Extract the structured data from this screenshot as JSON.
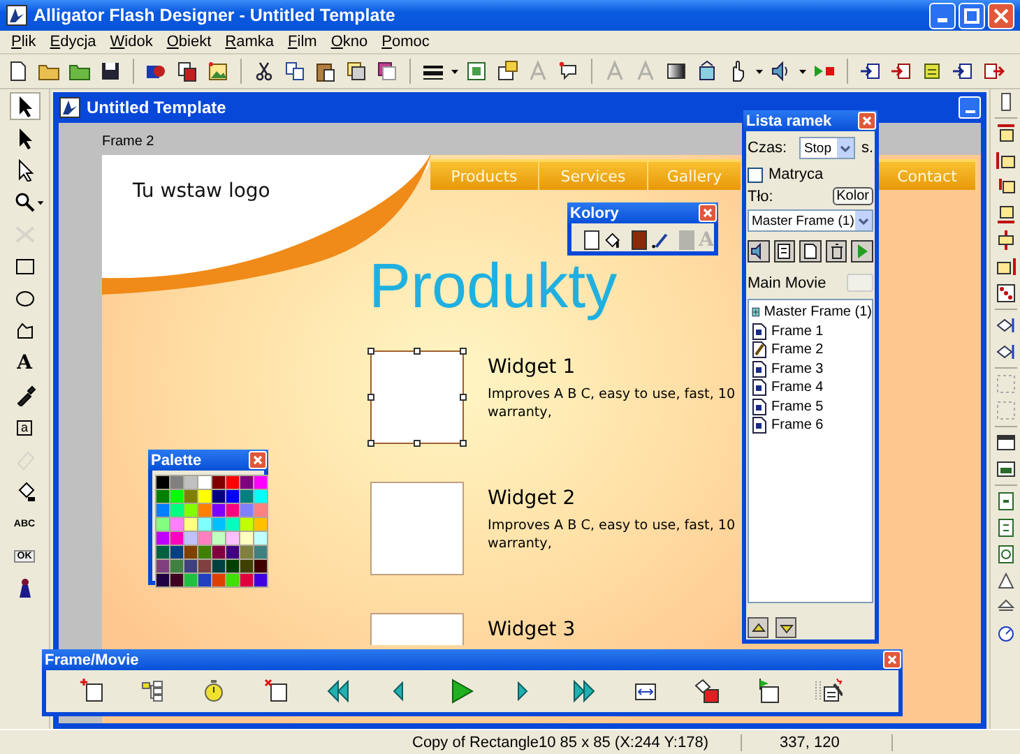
{
  "window": {
    "title": "Alligator Flash Designer - Untitled Template"
  },
  "menu": [
    "Plik",
    "Edycja",
    "Widok",
    "Obiekt",
    "Ramka",
    "Film",
    "Okno",
    "Pomoc"
  ],
  "toolbox": [
    {
      "kind": "select",
      "selected": true,
      "disabled": false
    },
    {
      "kind": "pointer",
      "selected": false,
      "disabled": false
    },
    {
      "kind": "node",
      "selected": false,
      "disabled": false
    },
    {
      "kind": "zoom",
      "selected": false,
      "disabled": false
    },
    {
      "kind": "cross",
      "selected": false,
      "disabled": true
    },
    {
      "kind": "rectangle",
      "selected": false,
      "disabled": false
    },
    {
      "kind": "ellipse",
      "selected": false,
      "disabled": false
    },
    {
      "kind": "polygon",
      "selected": false,
      "disabled": false
    },
    {
      "kind": "text",
      "label": "A",
      "selected": false,
      "disabled": false
    },
    {
      "kind": "dropper",
      "selected": false,
      "disabled": false
    },
    {
      "kind": "edit",
      "label": "a",
      "selected": false,
      "disabled": false
    },
    {
      "kind": "eraser",
      "selected": false,
      "disabled": true
    },
    {
      "kind": "fill",
      "selected": false,
      "disabled": false
    },
    {
      "kind": "label",
      "label": "ABC",
      "selected": false,
      "disabled": false
    },
    {
      "kind": "button",
      "label": "OK",
      "selected": false,
      "disabled": false
    },
    {
      "kind": "figure",
      "selected": false,
      "disabled": false
    }
  ],
  "document": {
    "title": "Untitled Template",
    "frame_label": "Frame 2"
  },
  "page": {
    "logo_text": "Tu wstaw logo",
    "nav": [
      "Products",
      "Services",
      "Gallery",
      "Contact"
    ],
    "heading": "Produkty",
    "widgets": [
      {
        "title": "Widget 1",
        "description": "Improves A B C, easy to use, fast, 10\nwarranty,",
        "selected": true
      },
      {
        "title": "Widget 2",
        "description": "Improves A B C, easy to use, fast, 10\nwarranty,",
        "selected": false
      },
      {
        "title": "Widget 3",
        "selected": false
      }
    ]
  },
  "frame_list": {
    "title": "Lista ramek",
    "time_label": "Czas:",
    "time_value": "Stop",
    "time_unit": "s.",
    "matrix": {
      "label": "Matryca",
      "checked": false
    },
    "background_label": "Tło:",
    "color_button": "Kolor",
    "frame_select": "Master Frame (1)",
    "movie_label": "Main Movie",
    "frames": [
      {
        "label": "Master Frame (1)",
        "kind": "master"
      },
      {
        "label": "Frame 1",
        "kind": "frame"
      },
      {
        "label": "Frame 2",
        "kind": "edited"
      },
      {
        "label": "Frame 3",
        "kind": "frame"
      },
      {
        "label": "Frame 4",
        "kind": "frame"
      },
      {
        "label": "Frame 5",
        "kind": "frame"
      },
      {
        "label": "Frame 6",
        "kind": "frame"
      }
    ]
  },
  "colors_panel": {
    "title": "Kolory",
    "swatches": [
      {
        "kind": "fill",
        "color": "#ffffff"
      },
      {
        "kind": "line",
        "color": "#8b2a0a"
      },
      {
        "kind": "text",
        "color": "#b4b4ac",
        "glyph": "A"
      }
    ]
  },
  "palette": {
    "title": "Palette",
    "colors": [
      {
        "color": "#000000"
      },
      {
        "color": "#808080"
      },
      {
        "color": "#c0c0c0"
      },
      {
        "color": "#ffffff"
      },
      {
        "color": "#800000"
      },
      {
        "color": "#ff0000"
      },
      {
        "color": "#800080"
      },
      {
        "color": "#ff00ff"
      },
      {
        "color": "#008000"
      },
      {
        "color": "#00ff00"
      },
      {
        "color": "#808000"
      },
      {
        "color": "#ffff00"
      },
      {
        "color": "#000080"
      },
      {
        "color": "#0000ff"
      },
      {
        "color": "#008080"
      },
      {
        "color": "#00ffff"
      },
      {
        "color": "#0080ff"
      },
      {
        "color": "#00ff80"
      },
      {
        "color": "#80ff00"
      },
      {
        "color": "#ff8000"
      },
      {
        "color": "#8000ff"
      },
      {
        "color": "#ff0080"
      },
      {
        "color": "#8080ff"
      },
      {
        "color": "#ff8080"
      },
      {
        "color": "#80ff80"
      },
      {
        "color": "#ff80ff"
      },
      {
        "color": "#ffff80"
      },
      {
        "color": "#80ffff"
      },
      {
        "color": "#00c0ff"
      },
      {
        "color": "#00ffc0"
      },
      {
        "color": "#c0ff00"
      },
      {
        "color": "#ffc000"
      },
      {
        "color": "#c000ff"
      },
      {
        "color": "#ff00c0"
      },
      {
        "color": "#c0c0ff"
      },
      {
        "color": "#ff80c0"
      },
      {
        "color": "#c0ffc0"
      },
      {
        "color": "#ffc0ff"
      },
      {
        "color": "#ffffc0"
      },
      {
        "color": "#c0ffff"
      },
      {
        "color": "#006040"
      },
      {
        "color": "#004080"
      },
      {
        "color": "#804000"
      },
      {
        "color": "#408000"
      },
      {
        "color": "#800040"
      },
      {
        "color": "#400080"
      },
      {
        "color": "#808040"
      },
      {
        "color": "#408080"
      },
      {
        "color": "#804080"
      },
      {
        "color": "#408040"
      },
      {
        "color": "#404080"
      },
      {
        "color": "#804040"
      },
      {
        "color": "#004040"
      },
      {
        "color": "#004000"
      },
      {
        "color": "#404000"
      },
      {
        "color": "#400000"
      },
      {
        "color": "#200040"
      },
      {
        "color": "#400020"
      },
      {
        "color": "#20c040"
      },
      {
        "color": "#2040c0"
      },
      {
        "color": "#e04000"
      },
      {
        "color": "#40e000"
      },
      {
        "color": "#e00040"
      },
      {
        "color": "#4000e0"
      }
    ]
  },
  "frame_movie": {
    "title": "Frame/Movie"
  },
  "status_bar": {
    "object_info": "Copy of Rectangle10 85 x 85 (X:244 Y:178)",
    "coordinates": "337, 120"
  }
}
